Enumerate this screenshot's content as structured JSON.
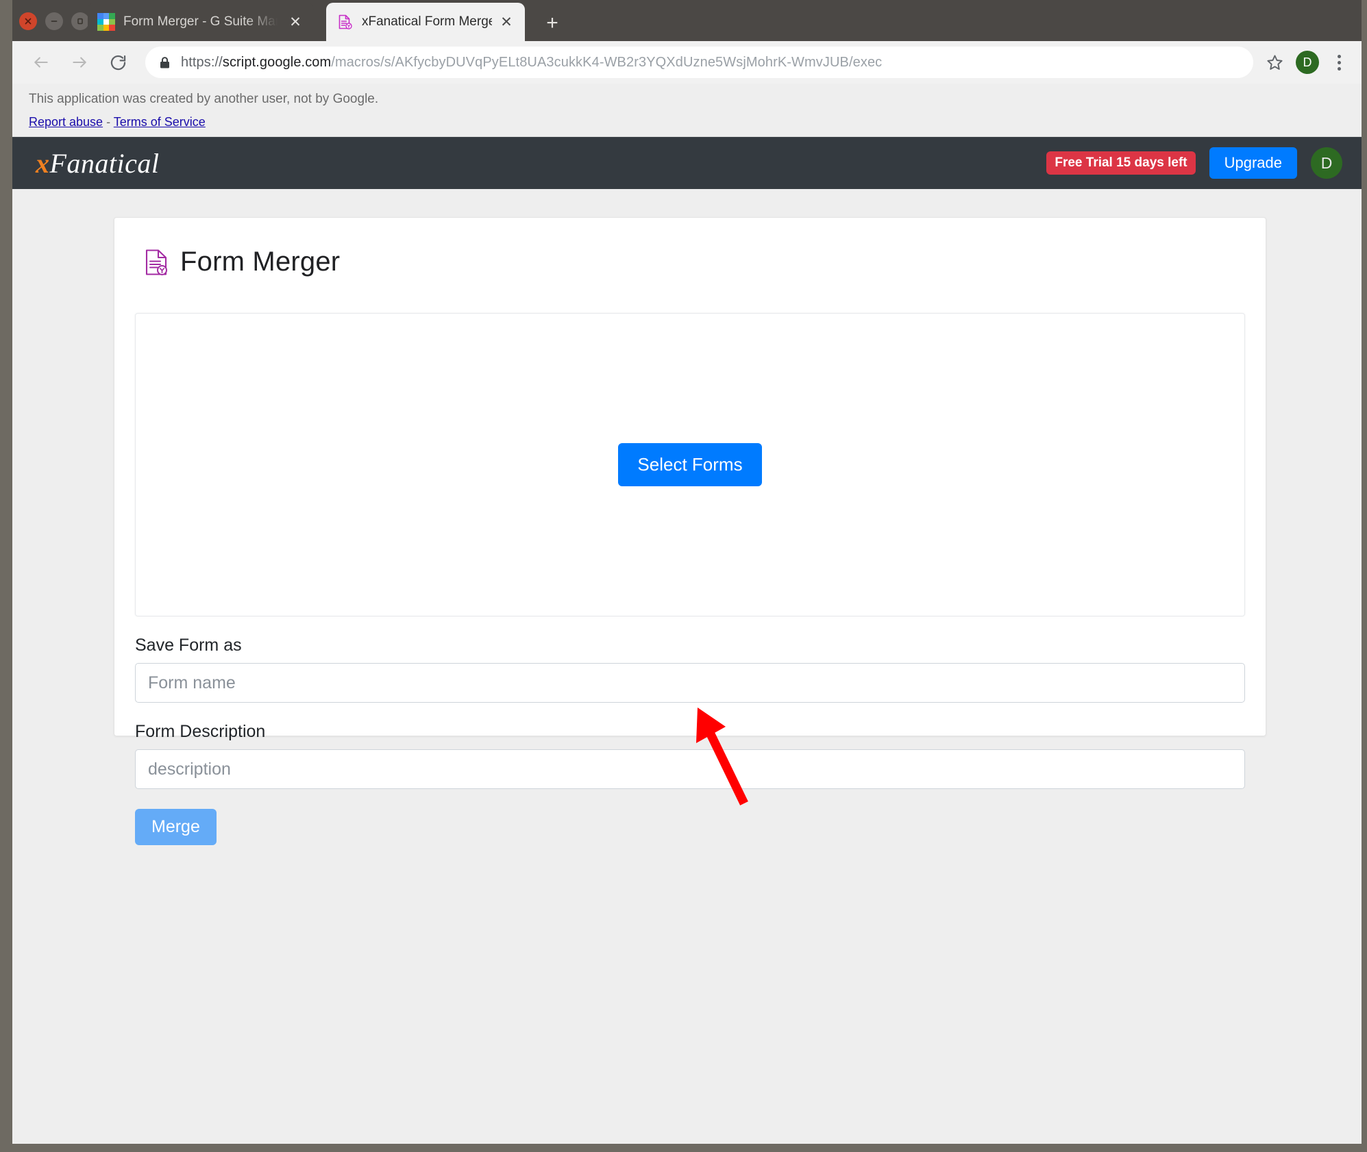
{
  "browser": {
    "window_controls": [
      "close",
      "minimize",
      "maximize"
    ],
    "tabs": [
      {
        "title": "Form Merger - G Suite Marketpla",
        "favicon": "gsuite-marketplace-icon",
        "active": false,
        "close_label": "✕"
      },
      {
        "title": "xFanatical Form Merger",
        "favicon": "form-merger-icon",
        "active": true,
        "close_label": "✕"
      }
    ],
    "new_tab_label": "+",
    "nav": {
      "back": "back-arrow",
      "forward": "forward-arrow",
      "reload": "reload-icon"
    },
    "address": {
      "lock": "lock-icon",
      "scheme": "https://",
      "host": "script.google.com",
      "path": "/macros/s/AKfycbyDUVqPyELt8UA3cukkK4-WB2r3YQXdUzne5WsjMohrK-WmvJUB/exec",
      "full": "https://script.google.com/macros/s/AKfycbyDUVqPyELt8UA3cukkK4-WB2r3YQXdUzne5WsjMohrK-WmvJUB/exec"
    },
    "toolbar_right": {
      "bookmark": "star-icon",
      "profile_initial": "D",
      "menu": "kebab-menu-icon"
    }
  },
  "infobar": {
    "message": "This application was created by another user, not by Google.",
    "links": [
      {
        "label": "Report abuse"
      },
      {
        "label": "Terms of Service"
      }
    ],
    "separator": "-"
  },
  "app_header": {
    "brand_x": "x",
    "brand_name": "Fanatical",
    "trial_badge": "Free Trial 15 days left",
    "upgrade_label": "Upgrade",
    "avatar_initial": "D"
  },
  "card": {
    "icon": "form-merger-document-icon",
    "title": "Form Merger",
    "dropzone": {
      "select_forms_label": "Select Forms"
    },
    "fields": [
      {
        "label": "Save Form as",
        "placeholder": "Form name",
        "value": ""
      },
      {
        "label": "Form Description",
        "placeholder": "description",
        "value": ""
      }
    ],
    "merge_label": "Merge"
  },
  "annotation": {
    "type": "arrow",
    "color": "#ff0000",
    "points_to": "Select Forms"
  },
  "colors": {
    "brand_accent": "#f08020",
    "header_bg": "#343a40",
    "primary_button": "#007bff",
    "disabled_button": "#64abf7",
    "danger_badge": "#dc3545",
    "avatar_green": "#2d6a22",
    "icon_purple": "#a32ba3",
    "page_bg": "#eeeeee",
    "annotation_red": "#ff0000"
  }
}
